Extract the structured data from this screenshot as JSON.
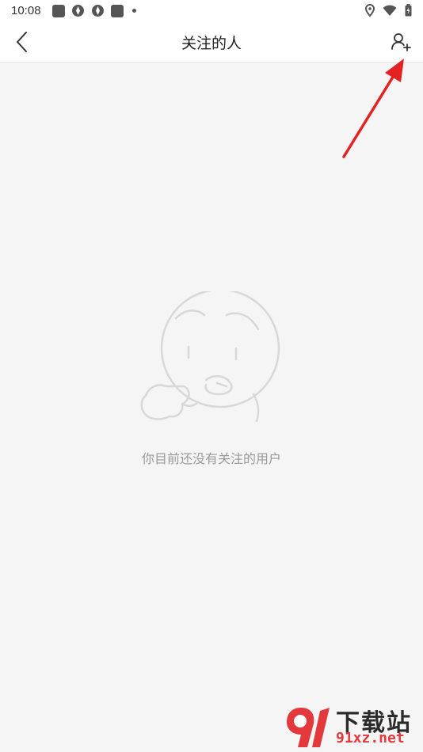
{
  "status_bar": {
    "time": "10:08"
  },
  "header": {
    "title": "关注的人",
    "back_icon": "chevron-left-icon",
    "add_icon": "add-user-icon"
  },
  "empty_state": {
    "message": "你目前还没有关注的用户",
    "illustration": "sad-face-illustration"
  },
  "watermark": {
    "brand": "下载站",
    "site": "91xz.net"
  },
  "colors": {
    "annotation_arrow": "#e52222",
    "empty_text": "#9a9a9a",
    "background": "#f5f5f5",
    "watermark_accent": "#e3393c"
  }
}
